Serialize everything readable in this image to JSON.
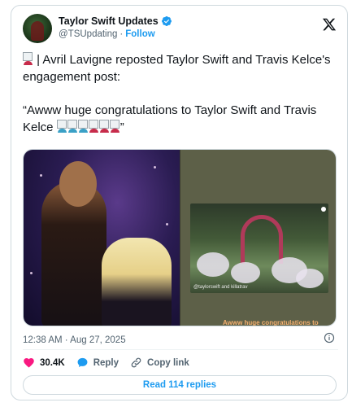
{
  "author": {
    "name": "Taylor Swift Updates",
    "handle": "@TSUpdating",
    "separator": "·",
    "follow_label": "Follow"
  },
  "post": {
    "line1": " | Avril Lavigne reposted Taylor Swift and Travis Kelce's engagement post:",
    "quote_part1": "“Awww huge congratulations to Taylor Swift and Travis Kelce",
    "quote_part2": "”"
  },
  "media": {
    "story_tag": "@taylorswift and killatrav",
    "story_caption": "Awww huge congratulations to"
  },
  "timestamp": "12:38 AM · Aug 27, 2025",
  "actions": {
    "likes": "30.4K",
    "reply_label": "Reply",
    "copy_link_label": "Copy link"
  },
  "replies_button": "Read 114 replies",
  "icons": [
    "verified-badge-icon",
    "x-logo-icon",
    "info-icon",
    "heart-icon",
    "reply-icon",
    "link-icon"
  ],
  "colors": {
    "accent": "#1d9bf0",
    "like": "#f91880",
    "muted": "#536471"
  }
}
